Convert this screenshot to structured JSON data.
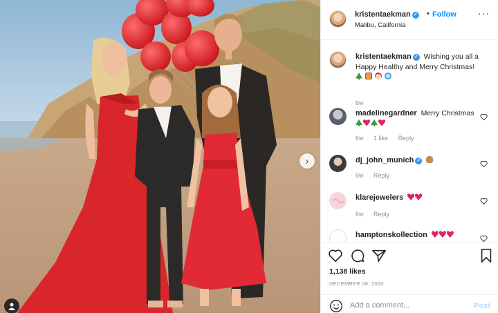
{
  "post": {
    "username": "kristentaekman",
    "follow_label": "Follow",
    "location": "Malibu, California",
    "more_icon": "more-horizontal-icon"
  },
  "caption": {
    "username": "kristentaekman",
    "text": "Wishing you all a Happy Healthy and Merry Christmas!",
    "emojis": [
      "christmas-tree",
      "gift",
      "santa",
      "snowflake"
    ],
    "age": "6w"
  },
  "comments": [
    {
      "username": "madelinegardner",
      "text": "Merry Christmas",
      "emojis": [
        "christmas-tree",
        "heart",
        "christmas-tree",
        "heart"
      ],
      "age": "6w",
      "likes": "1 like",
      "reply": "Reply"
    },
    {
      "username": "dj_john_munich",
      "verified": true,
      "emojis": [
        "hand"
      ],
      "age": "6w",
      "reply": "Reply"
    },
    {
      "username": "klarejewelers",
      "emojis": [
        "heart",
        "heart"
      ],
      "age": "6w",
      "reply": "Reply"
    },
    {
      "username": "hamptonskollection",
      "emojis": [
        "heart",
        "heart",
        "heart"
      ]
    }
  ],
  "actions": {
    "likes": "1,138 likes",
    "date": "DECEMBER 28, 2020"
  },
  "composer": {
    "placeholder": "Add a comment...",
    "post_label": "Post"
  },
  "colors": {
    "accent": "#0095f6",
    "verified": "#3897f0",
    "muted": "#8e8e8e",
    "dress_red": "#d8262a"
  }
}
